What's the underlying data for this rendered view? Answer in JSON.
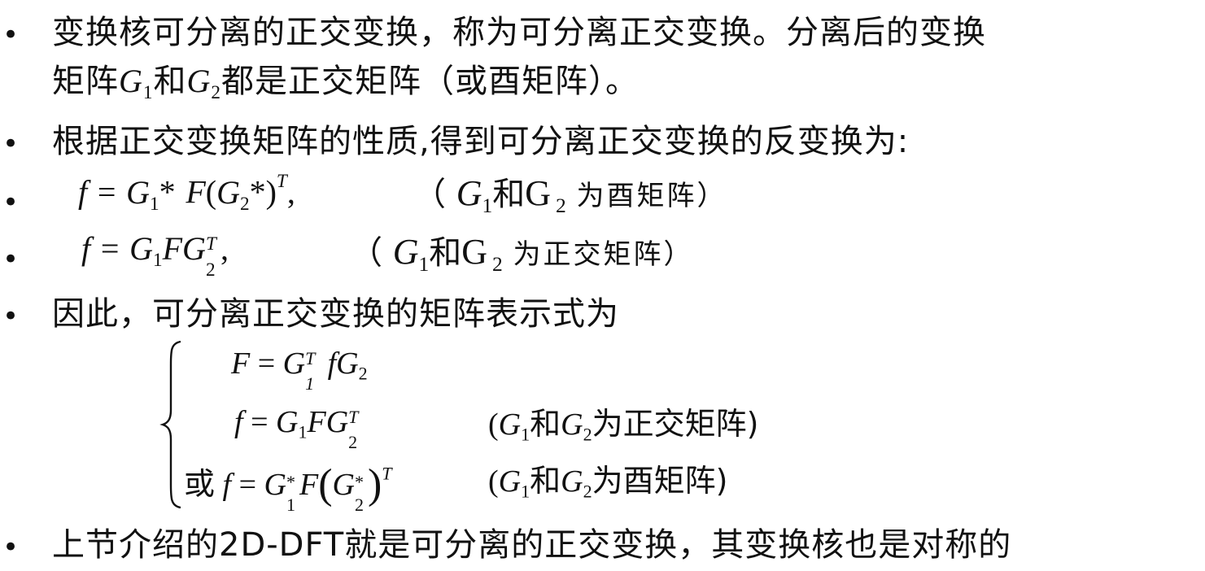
{
  "bullets": {
    "b1_line1": "变换核可分离的正交变换，称为可分离正交变换。分离后的变换",
    "b1_line2_pre": "矩阵",
    "b1_line2_mid": "和",
    "b1_line2_post": "都是正交矩阵（或酉矩阵）。",
    "b2": "根据正交变换矩阵的性质,得到可分离正交变换的反变换为:",
    "b5": "因此，可分离正交变换的矩阵表示式为",
    "b6": "上节介绍的2D-DFT就是可分离的正交变换，其变换核也是对称的"
  },
  "symbols": {
    "G": "G",
    "F": "F",
    "f": "f",
    "T": "T",
    "star": "*",
    "one": "1",
    "two": "2",
    "eq": "=",
    "lparen": "(",
    "rparen": ")",
    "comma": ",",
    "he": "和"
  },
  "eq1": {
    "open": "（",
    "note": "为酉矩阵）"
  },
  "eq2": {
    "open": "（",
    "note": "为正交矩阵）"
  },
  "system": {
    "or": "或",
    "note_orth": "为正交矩阵)",
    "note_unit": "为酉矩阵)"
  }
}
